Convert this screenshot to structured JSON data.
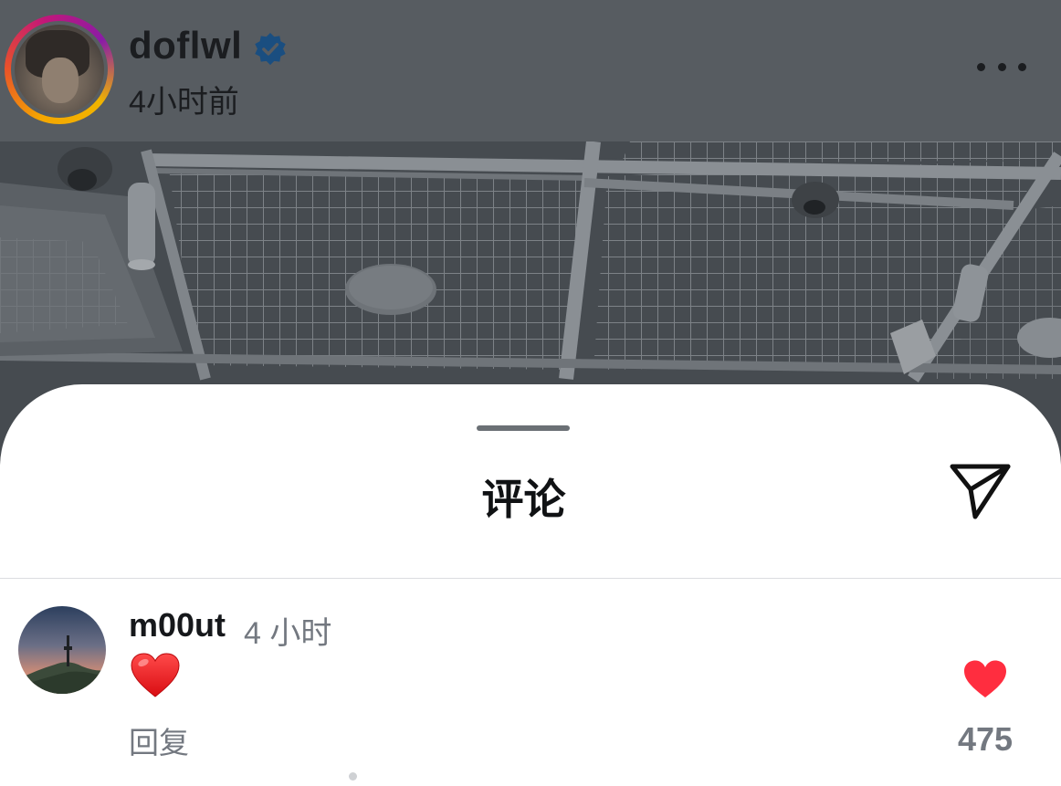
{
  "post": {
    "username": "doflwl",
    "verified": true,
    "time": "4小时前",
    "more_icon": "more-dots-icon"
  },
  "comments_sheet": {
    "title": "评论",
    "share_icon": "paper-plane-icon",
    "comments": [
      {
        "username": "m00ut",
        "time": "4 小时",
        "text": "❤️",
        "reply_label": "回复",
        "likes": "475",
        "liked": true
      }
    ]
  },
  "colors": {
    "verified": "#1877f2",
    "like": "#ff2d3f",
    "muted_text": "#737880"
  }
}
